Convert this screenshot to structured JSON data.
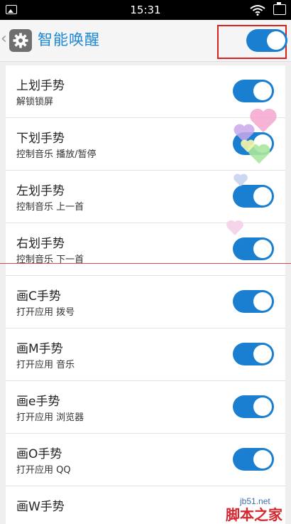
{
  "status_bar": {
    "time": "15:31"
  },
  "header": {
    "title": "智能唤醒",
    "master_toggle_on": true
  },
  "rows": [
    {
      "title": "上划手势",
      "subtitle": "解锁锁屏",
      "on": true
    },
    {
      "title": "下划手势",
      "subtitle": "控制音乐  播放/暂停",
      "on": true
    },
    {
      "title": "左划手势",
      "subtitle": "控制音乐  上一首",
      "on": true
    },
    {
      "title": "右划手势",
      "subtitle": "控制音乐  下一首",
      "on": true
    },
    {
      "title": "画C手势",
      "subtitle": "打开应用  拨号",
      "on": true
    },
    {
      "title": "画M手势",
      "subtitle": "打开应用  音乐",
      "on": true
    },
    {
      "title": "画e手势",
      "subtitle": "打开应用  浏览器",
      "on": true
    },
    {
      "title": "画O手势",
      "subtitle": "打开应用  QQ",
      "on": true
    },
    {
      "title": "画W手势",
      "subtitle": "",
      "on": true
    }
  ],
  "watermark": {
    "site": "jb51.net",
    "name": "脚本之家"
  },
  "colors": {
    "accent": "#1a7fd0",
    "title": "#1a87d4",
    "highlight": "#d8231f"
  },
  "icons": [
    "image-icon",
    "wifi-icon",
    "battery-icon",
    "back-chevron-icon",
    "settings-gear-icon",
    "heart-icon"
  ]
}
